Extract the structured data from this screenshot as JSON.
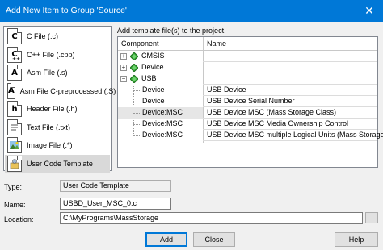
{
  "window": {
    "title": "Add New Item to Group 'Source'",
    "close_glyph": "✕"
  },
  "left_list": {
    "items": [
      {
        "label": "C File (.c)",
        "glyph": "C",
        "icon": "c-file-icon"
      },
      {
        "label": "C++ File (.cpp)",
        "glyph": "C",
        "icon": "cpp-file-icon"
      },
      {
        "label": "Asm File (.s)",
        "glyph": "A",
        "icon": "asm-file-icon"
      },
      {
        "label": "Asm File C-preprocessed (.S)",
        "glyph": "A",
        "icon": "asm-pre-file-icon"
      },
      {
        "label": "Header File (.h)",
        "glyph": "h",
        "icon": "header-file-icon"
      },
      {
        "label": "Text File (.txt)",
        "glyph": "",
        "icon": "text-file-icon"
      },
      {
        "label": "Image File (.*)",
        "glyph": "",
        "icon": "image-file-icon"
      },
      {
        "label": "User Code Template",
        "glyph": "",
        "icon": "user-code-template-icon"
      }
    ],
    "selected_index": 7
  },
  "instruction": "Add template file(s) to the project.",
  "grid": {
    "headers": {
      "component": "Component",
      "name": "Name"
    },
    "rows": [
      {
        "component": "CMSIS",
        "name": "",
        "level": 0,
        "expander": "+"
      },
      {
        "component": "Device",
        "name": "",
        "level": 0,
        "expander": "+"
      },
      {
        "component": "USB",
        "name": "",
        "level": 0,
        "expander": "−"
      },
      {
        "component": "Device",
        "name": "USB Device",
        "level": 1
      },
      {
        "component": "Device",
        "name": "USB Device Serial Number",
        "level": 1
      },
      {
        "component": "Device:MSC",
        "name": "USB Device MSC (Mass Storage Class)",
        "level": 1
      },
      {
        "component": "Device:MSC",
        "name": "USB Device MSC Media Ownership Control",
        "level": 1
      },
      {
        "component": "Device:MSC",
        "name": "USB Device MSC multiple Logical Units (Mass Storage ...",
        "level": 1
      }
    ]
  },
  "form": {
    "type_label": "Type:",
    "type_value": "User Code Template",
    "name_label": "Name:",
    "name_value": "USBD_User_MSC_0.c",
    "location_label": "Location:",
    "location_value": "C:\\MyPrograms\\MassStorage",
    "browse_label": "..."
  },
  "buttons": {
    "add": "Add",
    "close": "Close",
    "help": "Help"
  },
  "colors": {
    "titlebar": "#0078d7",
    "gem": "#2e9e2e"
  }
}
